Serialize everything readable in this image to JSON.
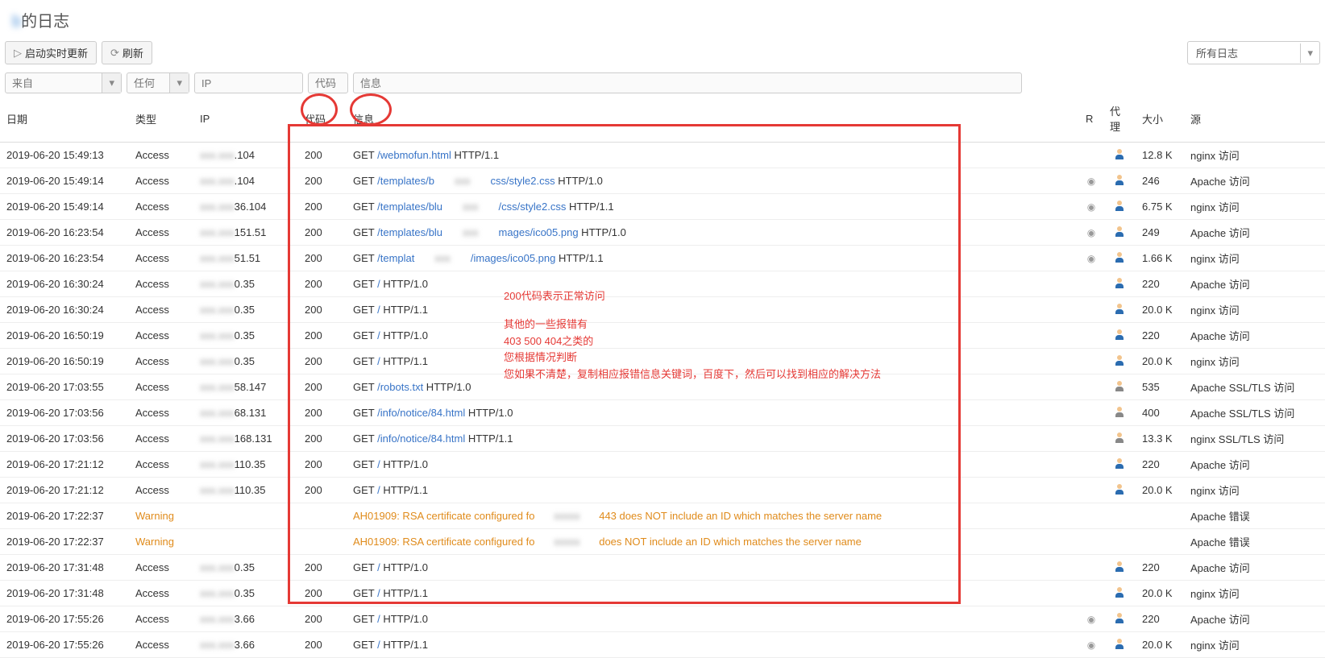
{
  "title_prefix": "b",
  "title_suffix": "的日志",
  "toolbar": {
    "realtime": "启动实时更新",
    "refresh": "刷新",
    "logfilter": "所有日志"
  },
  "filters": {
    "from": "来自",
    "any": "任何",
    "ip": "IP",
    "code": "代码",
    "info": "信息"
  },
  "columns": {
    "date": "日期",
    "type": "类型",
    "ip": "IP",
    "code": "代码",
    "info": "信息",
    "r": "R",
    "proxy": "代理",
    "size": "大小",
    "src": "源"
  },
  "annotations": {
    "l1": "200代码表示正常访问",
    "l2": "其他的一些报错有",
    "l3": "403  500  404之类的",
    "l4": "您根据情况判断",
    "l5": "您如果不清楚，复制相应报错信息关键词，百度下，然后可以找到相应的解决方法"
  },
  "rows": [
    {
      "date": "2019-06-20 15:49:13",
      "type": "Access",
      "ip_tail": ".104",
      "code": "200",
      "method": "GET",
      "path": "/webmofun.html",
      "proto": " HTTP/1.1",
      "r": "",
      "proxy": "person",
      "size": "12.8 K",
      "src": "nginx 访问"
    },
    {
      "date": "2019-06-20 15:49:14",
      "type": "Access",
      "ip_tail": ".104",
      "code": "200",
      "method": "GET",
      "path": "/templates/b",
      "path2": "css/style2.css",
      "proto": " HTTP/1.0",
      "r": "eye",
      "proxy": "person",
      "size": "246",
      "src": "Apache 访问"
    },
    {
      "date": "2019-06-20 15:49:14",
      "type": "Access",
      "ip_tail": "36.104",
      "code": "200",
      "method": "GET",
      "path": "/templates/blu",
      "path2": "/css/style2.css",
      "proto": " HTTP/1.1",
      "r": "eye",
      "proxy": "person",
      "size": "6.75 K",
      "src": "nginx 访问"
    },
    {
      "date": "2019-06-20 16:23:54",
      "type": "Access",
      "ip_tail": "151.51",
      "code": "200",
      "method": "GET",
      "path": "/templates/blu",
      "path2": "mages/ico05.png",
      "proto": " HTTP/1.0",
      "r": "eye",
      "proxy": "person",
      "size": "249",
      "src": "Apache 访问"
    },
    {
      "date": "2019-06-20 16:23:54",
      "type": "Access",
      "ip_tail": "51.51",
      "code": "200",
      "method": "GET",
      "path": "/templat",
      "path2": "/images/ico05.png",
      "proto": " HTTP/1.1",
      "r": "eye",
      "proxy": "person",
      "size": "1.66 K",
      "src": "nginx 访问"
    },
    {
      "date": "2019-06-20 16:30:24",
      "type": "Access",
      "ip_tail": "0.35",
      "code": "200",
      "method": "GET",
      "path": "/",
      "proto": " HTTP/1.0",
      "r": "",
      "proxy": "person",
      "size": "220",
      "src": "Apache 访问"
    },
    {
      "date": "2019-06-20 16:30:24",
      "type": "Access",
      "ip_tail": "0.35",
      "code": "200",
      "method": "GET",
      "path": "/",
      "proto": " HTTP/1.1",
      "r": "",
      "proxy": "person",
      "size": "20.0 K",
      "src": "nginx 访问"
    },
    {
      "date": "2019-06-20 16:50:19",
      "type": "Access",
      "ip_tail": "0.35",
      "code": "200",
      "method": "GET",
      "path": "/",
      "proto": " HTTP/1.0",
      "r": "",
      "proxy": "person",
      "size": "220",
      "src": "Apache 访问"
    },
    {
      "date": "2019-06-20 16:50:19",
      "type": "Access",
      "ip_tail": "0.35",
      "code": "200",
      "method": "GET",
      "path": "/",
      "proto": " HTTP/1.1",
      "r": "",
      "proxy": "person",
      "size": "20.0 K",
      "src": "nginx 访问"
    },
    {
      "date": "2019-06-20 17:03:55",
      "type": "Access",
      "ip_tail": "58.147",
      "code": "200",
      "method": "GET",
      "path": "/robots.txt",
      "proto": " HTTP/1.0",
      "r": "",
      "proxy": "ssl",
      "size": "535",
      "src": "Apache SSL/TLS 访问"
    },
    {
      "date": "2019-06-20 17:03:56",
      "type": "Access",
      "ip_tail": "68.131",
      "code": "200",
      "method": "GET",
      "path": "/info/notice/84.html",
      "proto": " HTTP/1.0",
      "r": "",
      "proxy": "ssl",
      "size": "400",
      "src": "Apache SSL/TLS 访问"
    },
    {
      "date": "2019-06-20 17:03:56",
      "type": "Access",
      "ip_tail": "168.131",
      "code": "200",
      "method": "GET",
      "path": "/info/notice/84.html",
      "proto": " HTTP/1.1",
      "r": "",
      "proxy": "ssl",
      "size": "13.3 K",
      "src": "nginx SSL/TLS 访问"
    },
    {
      "date": "2019-06-20 17:21:12",
      "type": "Access",
      "ip_tail": "110.35",
      "code": "200",
      "method": "GET",
      "path": "/",
      "proto": " HTTP/1.0",
      "r": "",
      "proxy": "person",
      "size": "220",
      "src": "Apache 访问"
    },
    {
      "date": "2019-06-20 17:21:12",
      "type": "Access",
      "ip_tail": "110.35",
      "code": "200",
      "method": "GET",
      "path": "/",
      "proto": " HTTP/1.1",
      "r": "",
      "proxy": "person",
      "size": "20.0 K",
      "src": "nginx 访问"
    },
    {
      "date": "2019-06-20 17:22:37",
      "type": "Warning",
      "ip_tail": "",
      "code": "",
      "warn": "AH01909: RSA certificate configured fo",
      "warn2": "443 does NOT include an ID which matches the server name",
      "r": "",
      "proxy": "",
      "size": "",
      "src": "Apache 错误"
    },
    {
      "date": "2019-06-20 17:22:37",
      "type": "Warning",
      "ip_tail": "",
      "code": "",
      "warn": "AH01909: RSA certificate configured fo",
      "warn2": "does NOT include an ID which matches the server name",
      "r": "",
      "proxy": "",
      "size": "",
      "src": "Apache 错误"
    },
    {
      "date": "2019-06-20 17:31:48",
      "type": "Access",
      "ip_tail": "0.35",
      "code": "200",
      "method": "GET",
      "path": "/",
      "proto": " HTTP/1.0",
      "r": "",
      "proxy": "person",
      "size": "220",
      "src": "Apache 访问"
    },
    {
      "date": "2019-06-20 17:31:48",
      "type": "Access",
      "ip_tail": "0.35",
      "code": "200",
      "method": "GET",
      "path": "/",
      "proto": " HTTP/1.1",
      "r": "",
      "proxy": "person",
      "size": "20.0 K",
      "src": "nginx 访问"
    },
    {
      "date": "2019-06-20 17:55:26",
      "type": "Access",
      "ip_tail": "3.66",
      "code": "200",
      "method": "GET",
      "path": "/",
      "proto": " HTTP/1.0",
      "r": "eye",
      "proxy": "person",
      "size": "220",
      "src": "Apache 访问"
    },
    {
      "date": "2019-06-20 17:55:26",
      "type": "Access",
      "ip_tail": "3.66",
      "code": "200",
      "method": "GET",
      "path": "/",
      "proto": " HTTP/1.1",
      "r": "eye",
      "proxy": "person",
      "size": "20.0 K",
      "src": "nginx 访问"
    }
  ]
}
